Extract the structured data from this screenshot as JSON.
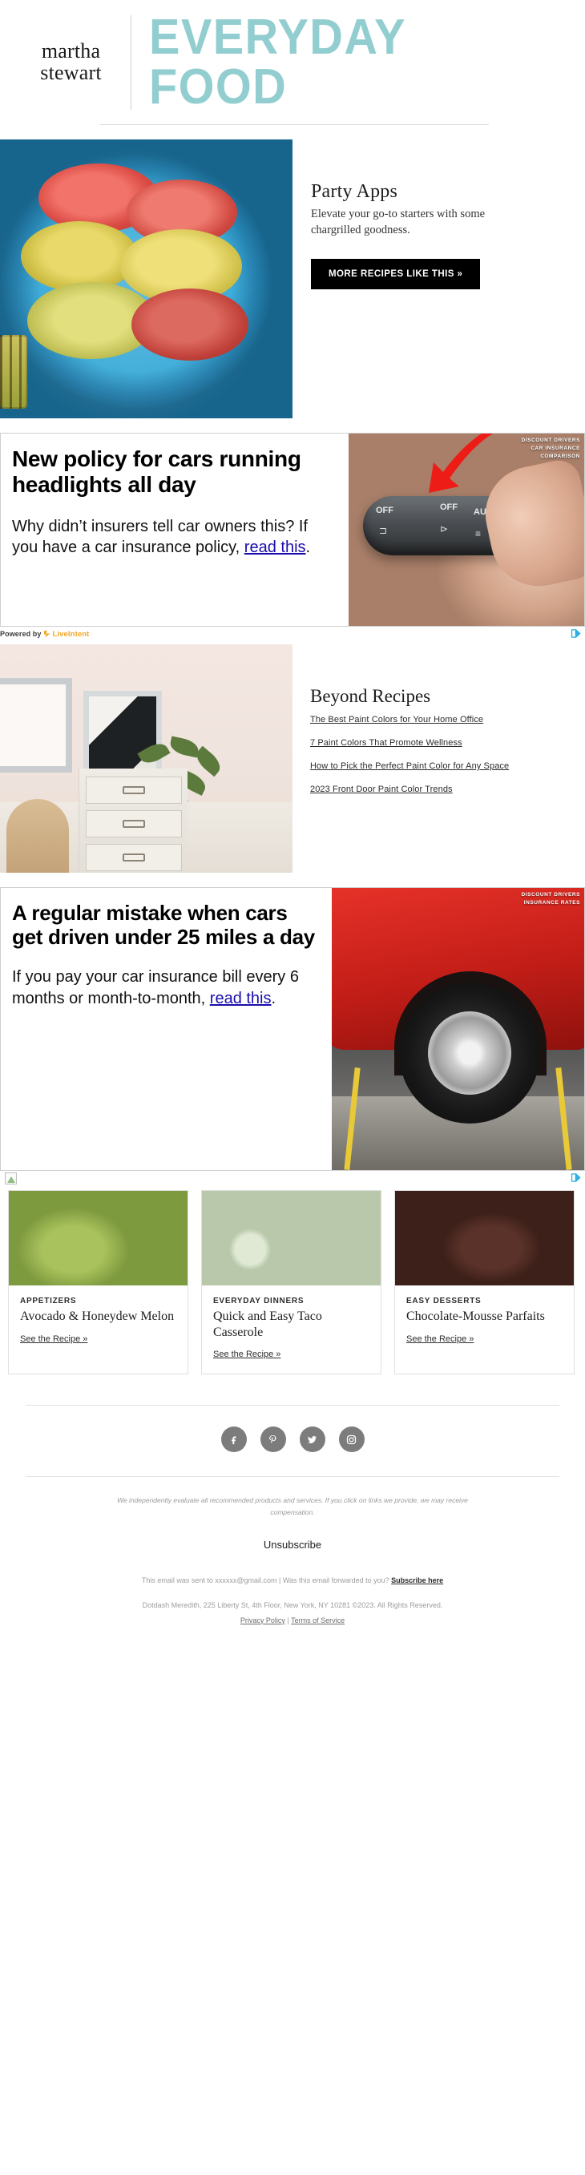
{
  "header": {
    "brand_line1": "martha",
    "brand_line2": "stewart",
    "masthead": "EVERYDAY FOOD",
    "accent_color": "#92cdcf"
  },
  "hero": {
    "title": "Party Apps",
    "subtitle": "Elevate your go-to starters with some chargrilled goodness.",
    "cta": "MORE RECIPES LIKE THIS »",
    "image_alt": "heirloom-tomato-plate"
  },
  "ads": [
    {
      "headline": "New policy for cars running headlights all day",
      "body_before": "Why didn’t insurers tell car owners this? If you have a car insurance policy, ",
      "link_text": "read this",
      "body_after": ".",
      "badge_line1": "DISCOUNT DRIVERS",
      "badge_line2": "CAR INSURANCE",
      "badge_line3": "COMPARISON",
      "powered_prefix": "Powered by",
      "powered_brand": "LiveIntent",
      "adchoices_label": "AdChoices",
      "image_alt": "hand-turning-headlight-stalk"
    },
    {
      "headline": "A regular mistake when cars get driven under 25 miles a day",
      "body_before": "If you pay your car insurance bill every 6 months or month-to-month, ",
      "link_text": "read this",
      "body_after": ".",
      "badge_line1": "DISCOUNT DRIVERS",
      "badge_line2": "INSURANCE RATES",
      "badge_line3": "",
      "powered_prefix": "",
      "powered_brand": "",
      "adchoices_label": "AdChoices",
      "image_alt": "red-car-wheel-on-pavement"
    }
  ],
  "beyond": {
    "title": "Beyond Recipes",
    "image_alt": "home-office-desk-with-plants",
    "links": [
      "The Best Paint Colors for Your Home Office",
      "7 Paint Colors That Promote Wellness",
      "How to Pick the Perfect Paint Color for Any Space",
      "2023 Front Door Paint Color Trends"
    ]
  },
  "cards": [
    {
      "kicker": "APPETIZERS",
      "title": "Avocado & Honeydew Melon",
      "link": "See the Recipe »",
      "image_alt": "avocado-and-melon-on-dark-slate"
    },
    {
      "kicker": "EVERYDAY DINNERS",
      "title": "Quick and Easy Taco Casserole",
      "link": "See the Recipe »",
      "image_alt": "taco-casserole-ingredients"
    },
    {
      "kicker": "EASY DESSERTS",
      "title": "Chocolate-Mousse Parfaits",
      "link": "See the Recipe »",
      "image_alt": "chocolate-mousse-parfait-bowl"
    }
  ],
  "footer": {
    "socials": [
      {
        "name": "facebook",
        "glyph": "f"
      },
      {
        "name": "pinterest",
        "glyph": "P"
      },
      {
        "name": "twitter",
        "glyph": "✈"
      },
      {
        "name": "instagram",
        "glyph": "□"
      }
    ],
    "disclaimer": "We independently evaluate all recommended products and services. If you click on links we provide, we may receive compensation.",
    "unsubscribe": "Unsubscribe",
    "sent_to": "This email was sent to xxxxxx@gmail.com",
    "separator": "|",
    "forwarded": "Was this email forwarded to you?",
    "subscribe_here": "Subscribe here",
    "address": "Dotdash Meredith, 225 Liberty St, 4th Floor, New York, NY 10281 ©2023. All Rights Reserved.",
    "privacy": "Privacy Policy",
    "terms": "Terms of Service"
  }
}
